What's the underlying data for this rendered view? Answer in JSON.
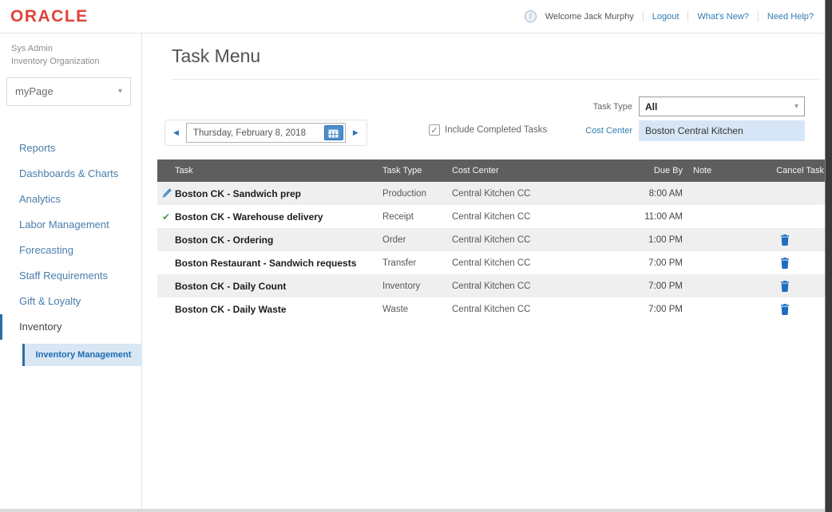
{
  "topbar": {
    "logo": "ORACLE",
    "welcome": "Welcome Jack Murphy",
    "links": [
      "Logout",
      "What's New?",
      "Need Help?"
    ],
    "info_glyph": "i"
  },
  "sidebar": {
    "role": "Sys Admin",
    "organization": "Inventory Organization",
    "page_select_value": "myPage",
    "select_caret": "▾",
    "nav": [
      "Reports",
      "Dashboards & Charts",
      "Analytics",
      "Labor Management",
      "Forecasting",
      "Staff Requirements",
      "Gift & Loyalty",
      "Inventory",
      "Inventory Management"
    ]
  },
  "main": {
    "title": "Task Menu",
    "filters": {
      "prev_icon": "◀",
      "next_icon": "▶",
      "date_value": "Thursday, February 8, 2018",
      "include_completed_label": "Include Completed Tasks",
      "checkbox_glyph": "✓",
      "task_type_label": "Task Type",
      "task_type_value": "All",
      "select_caret": "▾",
      "cost_center_label": "Cost Center",
      "cost_center_value": "Boston Central Kitchen"
    },
    "table": {
      "columns": [
        "Task",
        "Task Type",
        "Cost Center",
        "Due By",
        "Note",
        "Cancel Task"
      ],
      "check_glyph": "✔",
      "rows": [
        {
          "status_icon": "pencil-icon",
          "task": "Boston CK - Sandwich prep",
          "task_type": "Production",
          "cost_center": "Central Kitchen CC",
          "due_by": "8:00 AM",
          "note": "",
          "cancellable": false
        },
        {
          "status_icon": "check-icon",
          "task": "Boston CK - Warehouse delivery",
          "task_type": "Receipt",
          "cost_center": "Central Kitchen CC",
          "due_by": "11:00 AM",
          "note": "",
          "cancellable": false
        },
        {
          "status_icon": "",
          "task": "Boston CK - Ordering",
          "task_type": "Order",
          "cost_center": "Central Kitchen CC",
          "due_by": "1:00 PM",
          "note": "",
          "cancellable": true
        },
        {
          "status_icon": "",
          "task": "Boston Restaurant - Sandwich requests",
          "task_type": "Transfer",
          "cost_center": "Central Kitchen CC",
          "due_by": "7:00 PM",
          "note": "",
          "cancellable": true
        },
        {
          "status_icon": "",
          "task": "Boston CK - Daily Count",
          "task_type": "Inventory",
          "cost_center": "Central Kitchen CC",
          "due_by": "7:00 PM",
          "note": "",
          "cancellable": true
        },
        {
          "status_icon": "",
          "task": "Boston CK - Daily Waste",
          "task_type": "Waste",
          "cost_center": "Central Kitchen CC",
          "due_by": "7:00 PM",
          "note": "",
          "cancellable": true
        }
      ]
    }
  },
  "colors": {
    "oracle_red": "#e04338",
    "link_blue": "#2f7cb5",
    "nav_blue": "#4a7dab",
    "accent_blue": "#2e75b6",
    "active_item_bg": "#d9e6f4",
    "cost_field_bg": "#d6e6f6",
    "table_header_bg": "#5e5e5e",
    "row_alt_bg": "#efefef",
    "trash_blue": "#1d6ebf",
    "check_green": "#43a047"
  }
}
